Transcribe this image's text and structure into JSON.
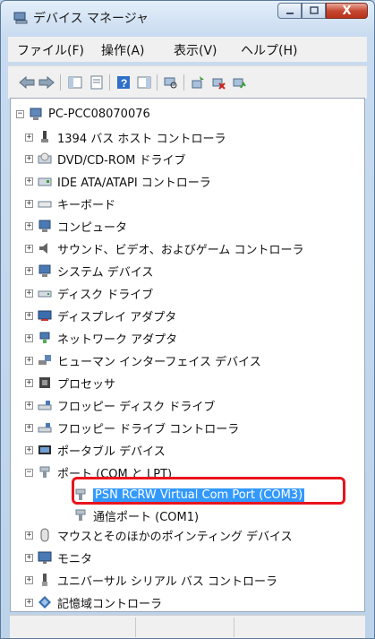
{
  "window": {
    "title": "デバイス マネージャ",
    "title_icon": "device-manager-icon"
  },
  "caption_buttons": {
    "close_glyph": "X"
  },
  "menu": [
    "ファイル(F)",
    "操作(A)",
    "表示(V)",
    "ヘルプ(H)"
  ],
  "toolbar_icons": [
    "back-arrow-icon",
    "forward-arrow-icon",
    "show-hide-console-tree-icon",
    "properties-icon",
    "help-icon",
    "action-pane-icon",
    "scan-hardware-icon",
    "update-driver-icon",
    "disable-device-icon",
    "uninstall-device-icon"
  ],
  "tree": {
    "root": "PC-PCC08070076",
    "categories": [
      "1394 バス ホスト コントローラ",
      "DVD/CD-ROM ドライブ",
      "IDE ATA/ATAPI コントローラ",
      "キーボード",
      "コンピュータ",
      "サウンド、ビデオ、およびゲーム コントローラ",
      "システム デバイス",
      "ディスク ドライブ",
      "ディスプレイ アダプタ",
      "ネットワーク アダプタ",
      "ヒューマン インターフェイス デバイス",
      "プロセッサ",
      "フロッピー ディスク ドライブ",
      "フロッピー ドライブ コントローラ",
      "ポータブル デバイス",
      "ポート (COM と LPT)"
    ],
    "ports_children": [
      "PSN RCRW Virtual Com Port (COM3)",
      "通信ポート (COM1)"
    ],
    "categories_after": [
      "マウスとそのほかのポインティング デバイス",
      "モニタ",
      "ユニバーサル シリアル バス コントローラ",
      "記憶域コントローラ"
    ]
  },
  "colors": {
    "selection": "#3399ff",
    "highlight_box": "#e8141c"
  }
}
